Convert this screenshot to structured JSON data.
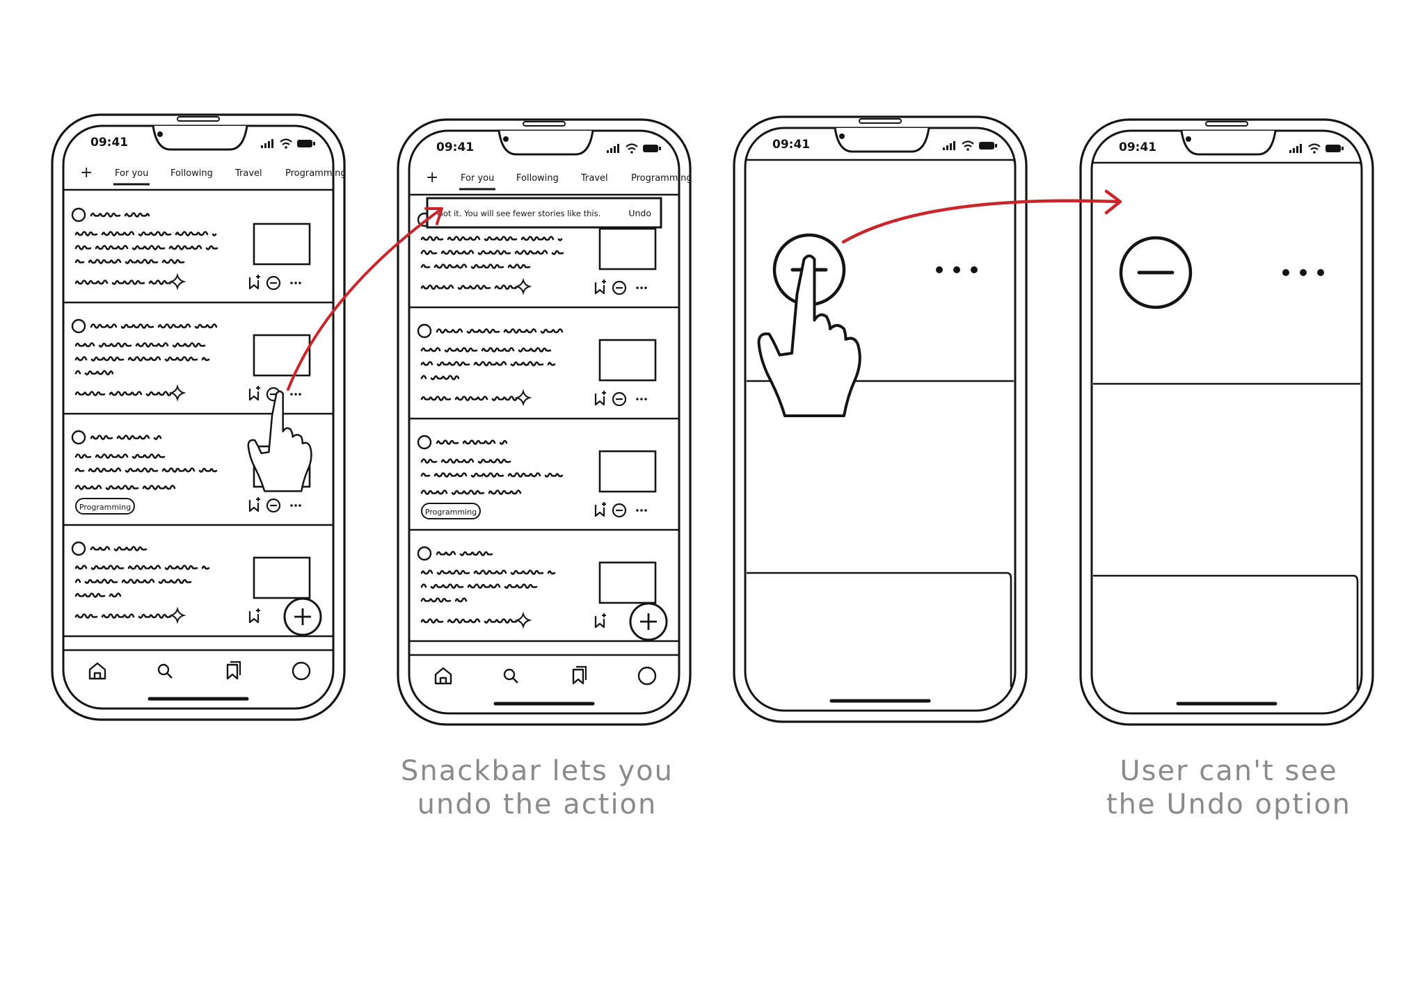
{
  "phone": {
    "time": "09:41",
    "tabs": [
      "For you",
      "Following",
      "Travel",
      "Programming"
    ],
    "add_tab_glyph": "+",
    "tag": "Programming",
    "nav_icons": [
      "home-icon",
      "search-icon",
      "bookmarks-icon",
      "profile-icon"
    ]
  },
  "snackbar": {
    "message": "Got it. You will see fewer stories like this.",
    "action": "Undo"
  },
  "captions": {
    "screen2": [
      "Snackbar lets you",
      "undo the action"
    ],
    "screen4": [
      "User can't see",
      "the Undo option"
    ]
  },
  "colors": {
    "ink": "#141414",
    "arrow": "#c8262b",
    "caption": "#8a8a8a"
  }
}
